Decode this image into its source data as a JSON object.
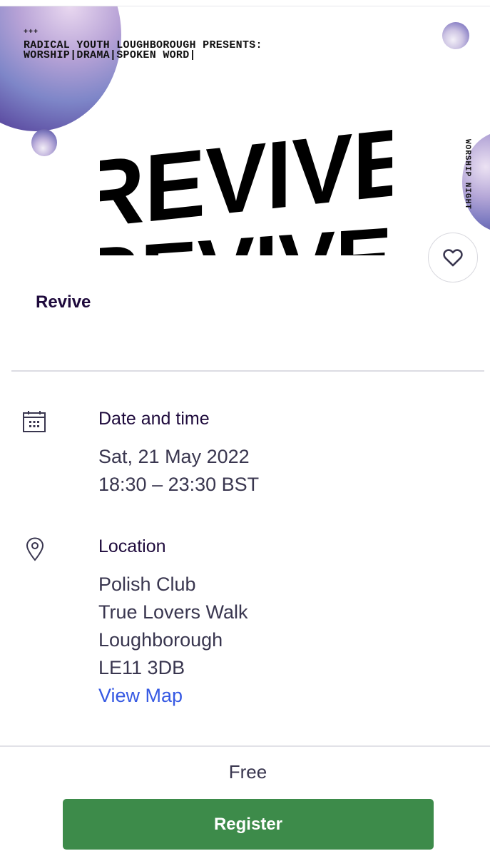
{
  "poster": {
    "plus_marks": "+++",
    "heading_line1": "RADICAL YOUTH LOUGHBOROUGH PRESENTS:",
    "heading_line2": "WORSHIP|DRAMA|SPOKEN WORD|",
    "side_text": "WORSHIP NIGHT",
    "wordart_text": "REVIVE"
  },
  "event": {
    "title": "Revive"
  },
  "date_time": {
    "label": "Date and time",
    "date": "Sat, 21 May 2022",
    "time": "18:30 – 23:30 BST",
    "icon": "calendar-icon"
  },
  "location": {
    "label": "Location",
    "venue": "Polish Club",
    "street": "True Lovers Walk",
    "town": "Loughborough",
    "postcode": "LE11 3DB",
    "map_link": "View Map",
    "icon": "map-pin-icon"
  },
  "footer": {
    "price": "Free",
    "register_label": "Register"
  },
  "colors": {
    "text_dark": "#1e0a3c",
    "text_body": "#39364f",
    "link": "#3659e3",
    "register_bg": "#3d8b4a"
  }
}
